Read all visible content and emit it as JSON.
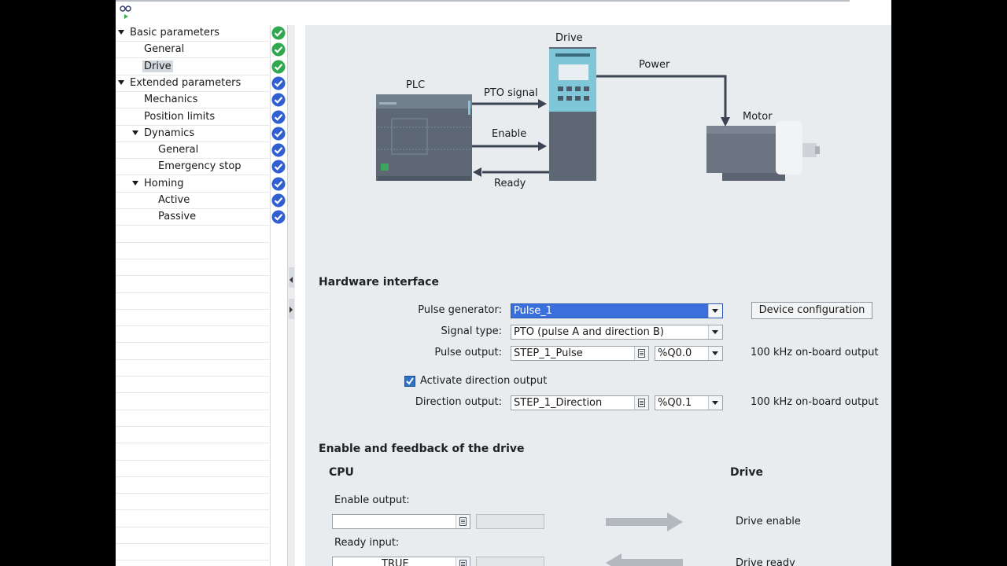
{
  "tree": {
    "items": [
      {
        "label": "Basic parameters",
        "level": 0,
        "expandable": true,
        "status": "ok"
      },
      {
        "label": "General",
        "level": 1,
        "expandable": false,
        "status": "ok"
      },
      {
        "label": "Drive",
        "level": 1,
        "expandable": false,
        "status": "ok",
        "selected": true
      },
      {
        "label": "Extended parameters",
        "level": 0,
        "expandable": true,
        "status": "done"
      },
      {
        "label": "Mechanics",
        "level": 1,
        "expandable": false,
        "status": "done"
      },
      {
        "label": "Position limits",
        "level": 1,
        "expandable": false,
        "status": "done"
      },
      {
        "label": "Dynamics",
        "level": 1,
        "expandable": true,
        "status": "done"
      },
      {
        "label": "General",
        "level": 2,
        "expandable": false,
        "status": "done"
      },
      {
        "label": "Emergency stop",
        "level": 2,
        "expandable": false,
        "status": "done"
      },
      {
        "label": "Homing",
        "level": 1,
        "expandable": true,
        "status": "done"
      },
      {
        "label": "Active",
        "level": 2,
        "expandable": false,
        "status": "done"
      },
      {
        "label": "Passive",
        "level": 2,
        "expandable": false,
        "status": "done"
      }
    ]
  },
  "diagram": {
    "plc_label": "PLC",
    "drive_label": "Drive",
    "motor_label": "Motor",
    "power_label": "Power",
    "pto_label": "PTO signal",
    "enable_label": "Enable",
    "ready_label": "Ready"
  },
  "hardware": {
    "title": "Hardware interface",
    "pulse_generator_label": "Pulse generator:",
    "pulse_generator_value": "Pulse_1",
    "device_config_button": "Device configuration",
    "signal_type_label": "Signal type:",
    "signal_type_value": "PTO (pulse A and direction B)",
    "pulse_output_label": "Pulse output:",
    "pulse_output_value": "STEP_1_Pulse",
    "pulse_output_address": "%Q0.0",
    "pulse_output_note": "100 kHz on-board output",
    "activate_direction_label": "Activate direction output",
    "direction_output_label": "Direction output:",
    "direction_output_value": "STEP_1_Direction",
    "direction_output_address": "%Q0.1",
    "direction_output_note": "100 kHz on-board output"
  },
  "enable_feedback": {
    "title": "Enable and feedback of the drive",
    "cpu_heading": "CPU",
    "drive_heading": "Drive",
    "enable_output_label": "Enable output:",
    "enable_output_value": "",
    "drive_enable_label": "Drive enable",
    "ready_input_label": "Ready input:",
    "ready_input_value": "TRUE",
    "drive_ready_label": "Drive ready"
  },
  "colors": {
    "content_bg": "#e9ecef",
    "selection_blue": "#3b6fdc",
    "status_ok": "#2fa84f",
    "status_done": "#2f5fd0",
    "device_teal": "#7fc6d8",
    "device_gray": "#5e6875"
  }
}
